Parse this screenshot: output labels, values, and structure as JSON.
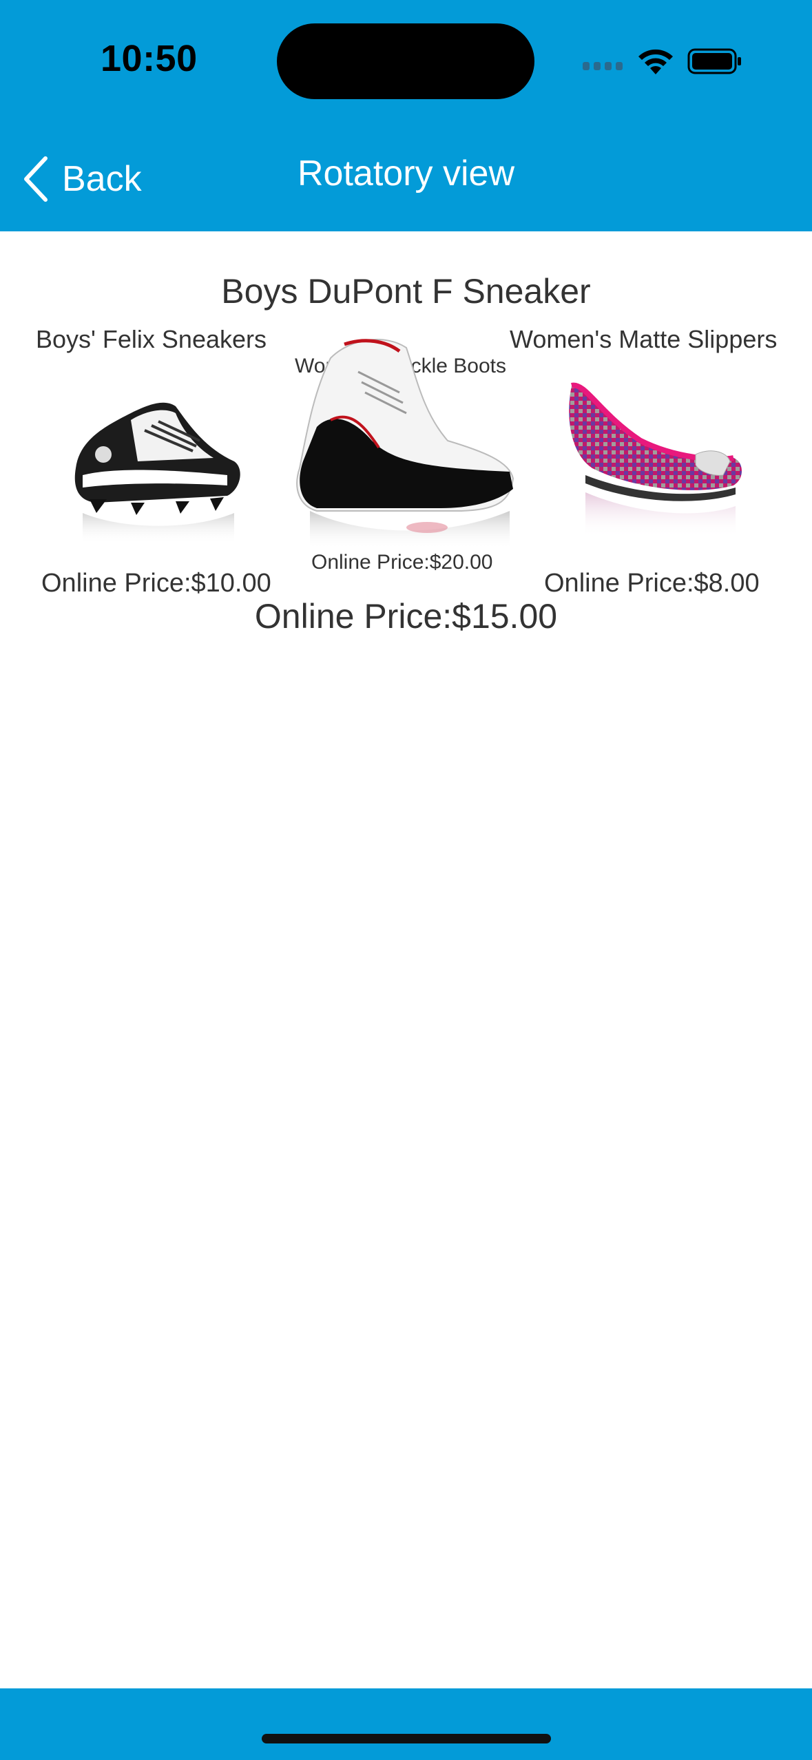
{
  "status_bar": {
    "time": "10:50"
  },
  "nav": {
    "back_label": "Back",
    "title": "Rotatory view"
  },
  "carousel": {
    "selected": {
      "title": "Boys DuPont F Sneaker",
      "price": "Online Price:$15.00"
    },
    "left": {
      "title": "Boys' Felix Sneakers",
      "price": "Online Price:$10.00"
    },
    "center": {
      "title": "Women's Buckle Boots",
      "price": "Online Price:$20.00"
    },
    "right": {
      "title": "Women's Matte Slippers",
      "price": "Online Price:$8.00"
    }
  },
  "colors": {
    "accent": "#039bd8",
    "text": "#333333"
  }
}
